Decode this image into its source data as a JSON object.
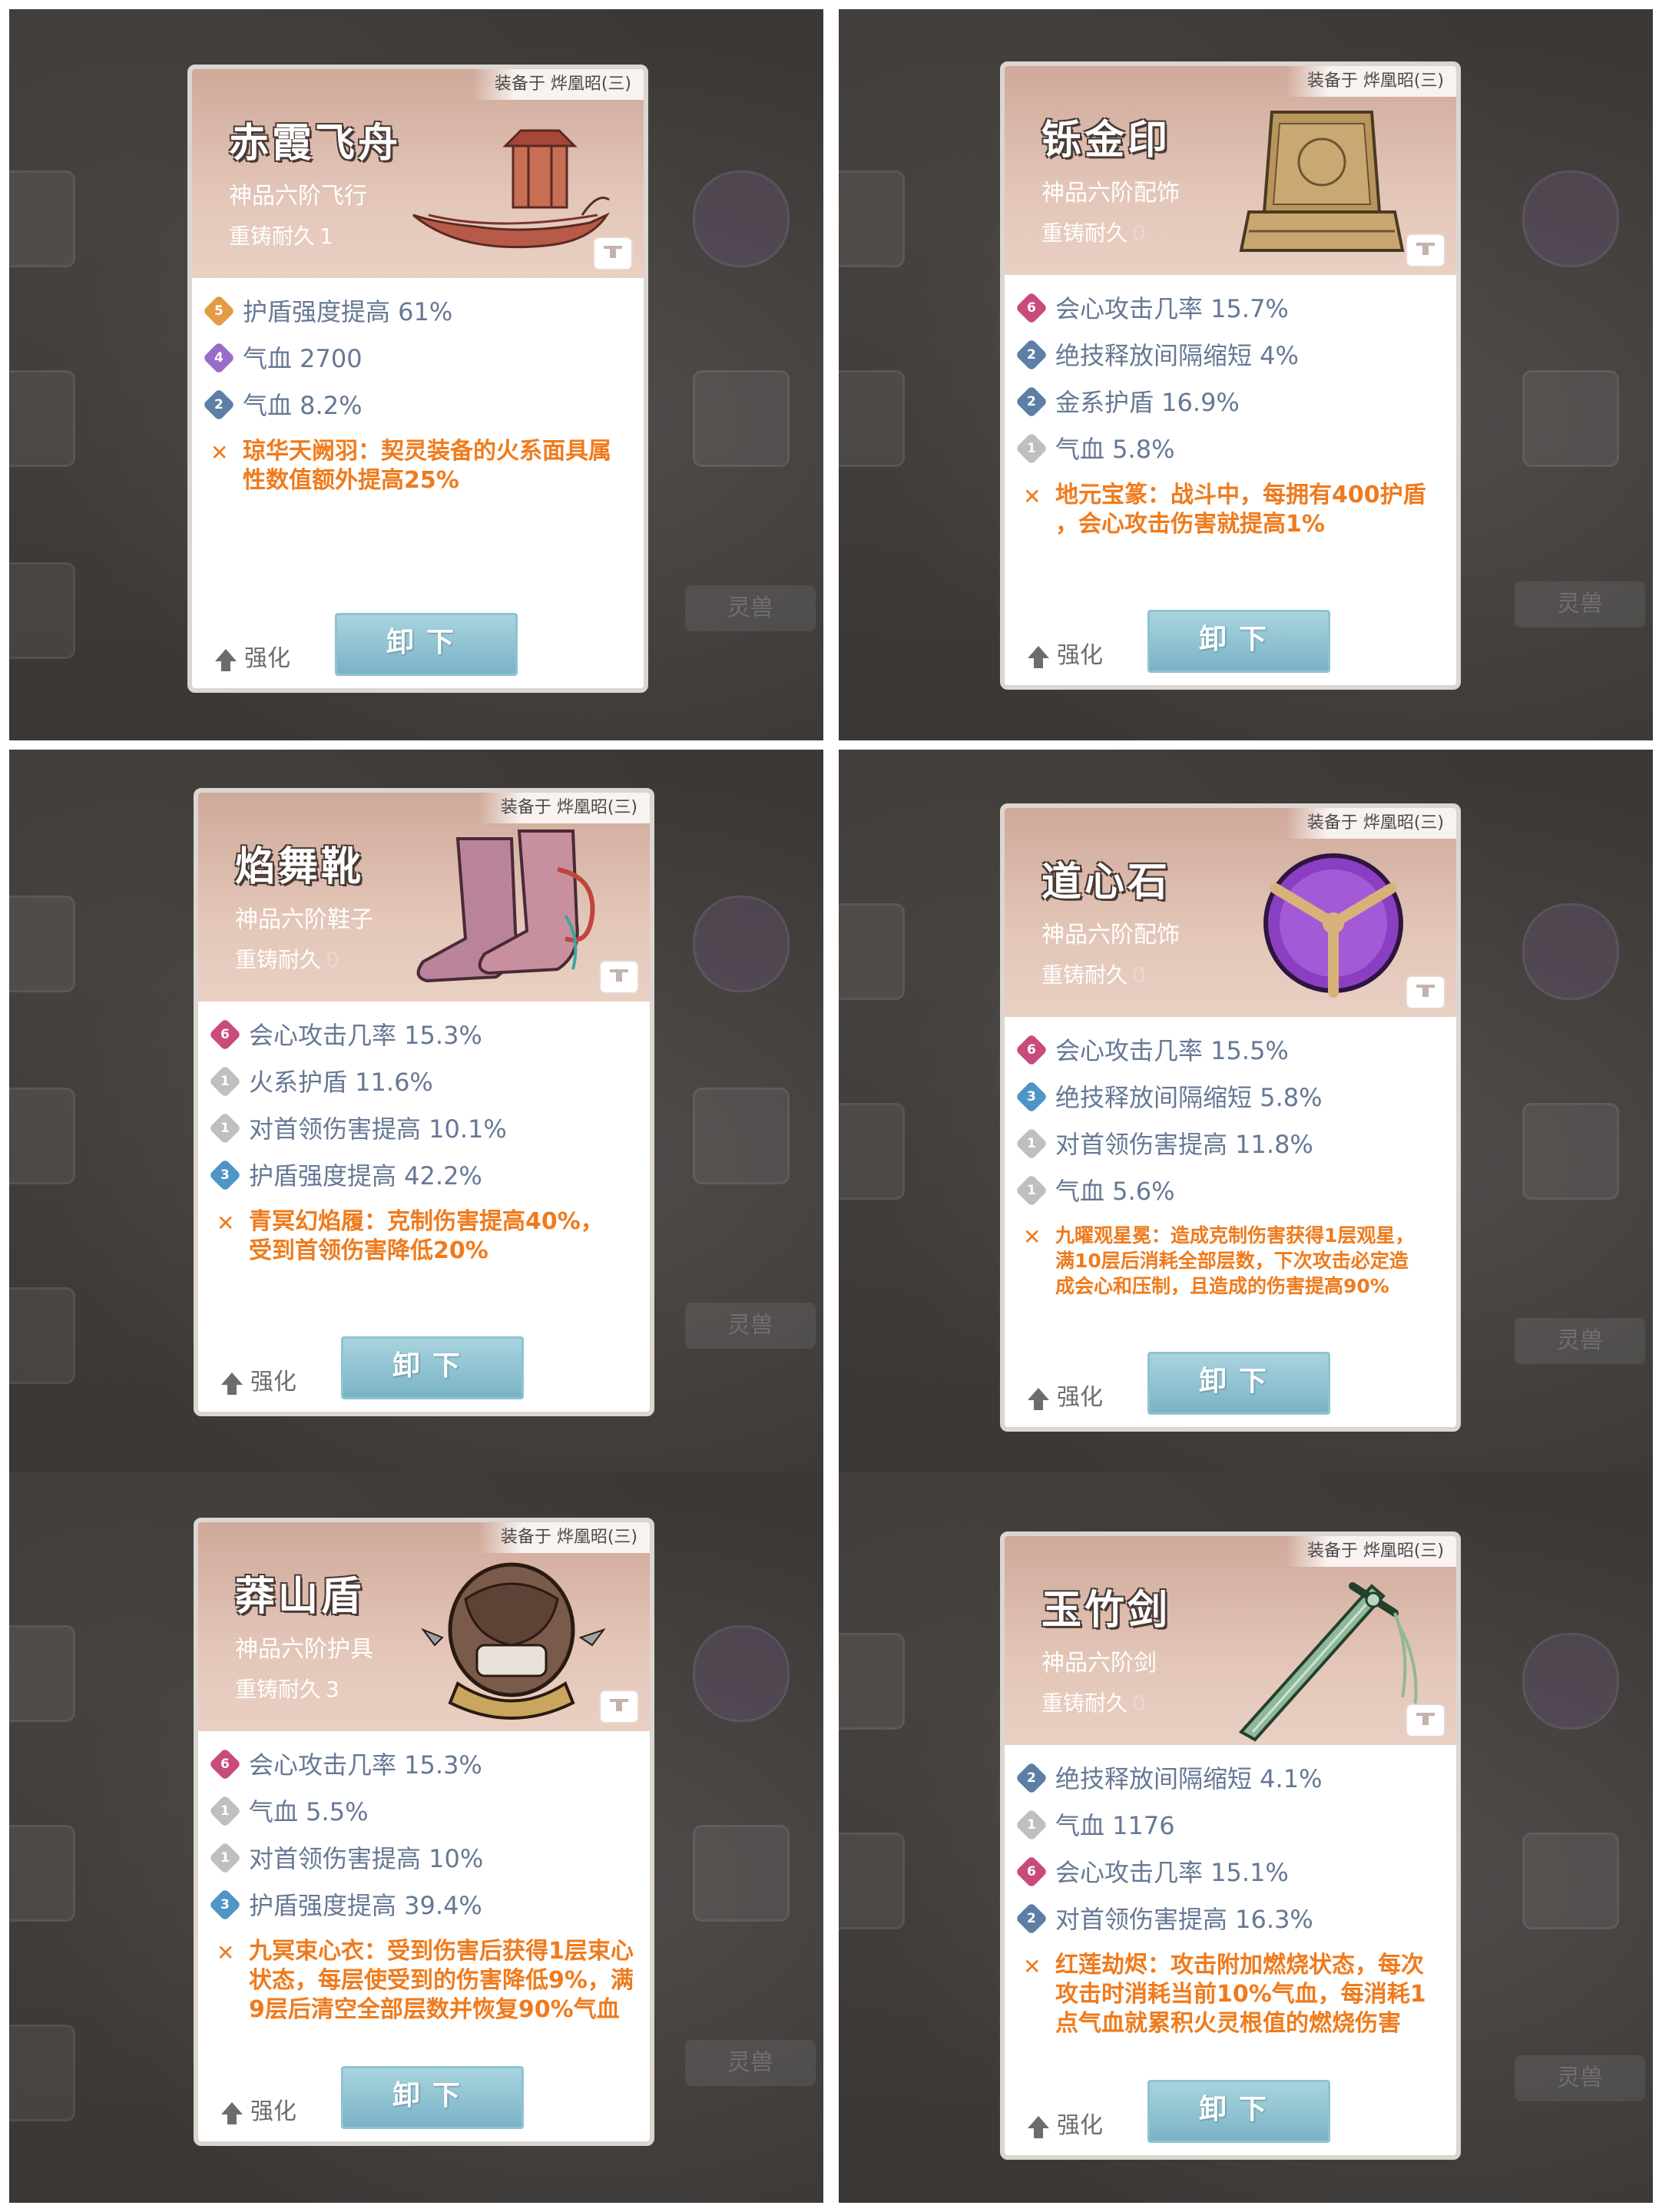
{
  "cards": [
    {
      "equip_tag": "装备于 烨凰昭(三)",
      "name": "赤霞飞舟",
      "grade": "神品六阶飞行",
      "recast_label": "重铸耐久",
      "recast_value": "1",
      "stats": [
        {
          "badge": "5",
          "color": "b5",
          "text": "护盾强度提高 61%"
        },
        {
          "badge": "4",
          "color": "b4",
          "text": "气血 2700"
        },
        {
          "badge": "2",
          "color": "b2",
          "text": "气血 8.2%"
        }
      ],
      "special_lines": [
        "琼华天阙羽：契灵装备的火系面具属",
        "性数值额外提高25%"
      ],
      "upgrade": "强化",
      "unequip": "卸下"
    },
    {
      "equip_tag": "装备于 烨凰昭(三)",
      "name": "铄金印",
      "grade": "神品六阶配饰",
      "recast_label": "重铸耐久",
      "recast_value": "0",
      "stats": [
        {
          "badge": "6",
          "color": "b6",
          "text": "会心攻击几率 15.7%"
        },
        {
          "badge": "2",
          "color": "b2",
          "text": "绝技释放间隔缩短 4%"
        },
        {
          "badge": "2",
          "color": "b2",
          "text": "金系护盾 16.9%"
        },
        {
          "badge": "1",
          "color": "b1",
          "text": "气血 5.8%"
        }
      ],
      "special_lines": [
        "地元宝篆：战斗中，每拥有400护盾",
        "，会心攻击伤害就提高1%"
      ],
      "upgrade": "强化",
      "unequip": "卸下"
    },
    {
      "equip_tag": "装备于 烨凰昭(三)",
      "name": "焰舞靴",
      "grade": "神品六阶鞋子",
      "recast_label": "重铸耐久",
      "recast_value": "0",
      "stats": [
        {
          "badge": "6",
          "color": "b6",
          "text": "会心攻击几率 15.3%"
        },
        {
          "badge": "1",
          "color": "b1",
          "text": "火系护盾 11.6%"
        },
        {
          "badge": "1",
          "color": "b1",
          "text": "对首领伤害提高 10.1%"
        },
        {
          "badge": "3",
          "color": "b3",
          "text": "护盾强度提高 42.2%"
        }
      ],
      "special_lines": [
        "青冥幻焰履：克制伤害提高40%，",
        "受到首领伤害降低20%"
      ],
      "upgrade": "强化",
      "unequip": "卸下"
    },
    {
      "equip_tag": "装备于 烨凰昭(三)",
      "name": "道心石",
      "grade": "神品六阶配饰",
      "recast_label": "重铸耐久",
      "recast_value": "0",
      "stats": [
        {
          "badge": "6",
          "color": "b6",
          "text": "会心攻击几率 15.5%"
        },
        {
          "badge": "3",
          "color": "b3",
          "text": "绝技释放间隔缩短 5.8%"
        },
        {
          "badge": "1",
          "color": "b1",
          "text": "对首领伤害提高 11.8%"
        },
        {
          "badge": "1",
          "color": "b1",
          "text": "气血 5.6%"
        }
      ],
      "special_lines": [
        "九曜观星冕：造成克制伤害获得1层观星，",
        "满10层后消耗全部层数，下次攻击必定造",
        "成会心和压制，且造成的伤害提高90%"
      ],
      "upgrade": "强化",
      "unequip": "卸下"
    },
    {
      "equip_tag": "装备于 烨凰昭(三)",
      "name": "莽山盾",
      "grade": "神品六阶护具",
      "recast_label": "重铸耐久",
      "recast_value": "3",
      "stats": [
        {
          "badge": "6",
          "color": "b6",
          "text": "会心攻击几率 15.3%"
        },
        {
          "badge": "1",
          "color": "b1",
          "text": "气血 5.5%"
        },
        {
          "badge": "1",
          "color": "b1",
          "text": "对首领伤害提高 10%"
        },
        {
          "badge": "3",
          "color": "b3",
          "text": "护盾强度提高 39.4%"
        }
      ],
      "special_lines": [
        "九冥束心衣：受到伤害后获得1层束心",
        "状态，每层使受到的伤害降低9%，满",
        "9层后清空全部层数并恢复90%气血"
      ],
      "upgrade": "强化",
      "unequip": "卸下"
    },
    {
      "equip_tag": "装备于 烨凰昭(三)",
      "name": "玉竹剑",
      "grade": "神品六阶剑",
      "recast_label": "重铸耐久",
      "recast_value": "0",
      "stats": [
        {
          "badge": "2",
          "color": "b2",
          "text": "绝技释放间隔缩短 4.1%"
        },
        {
          "badge": "1",
          "color": "b1",
          "text": "气血 1176"
        },
        {
          "badge": "6",
          "color": "b6",
          "text": "会心攻击几率 15.1%"
        },
        {
          "badge": "2",
          "color": "b2",
          "text": "对首领伤害提高 16.3%"
        }
      ],
      "special_lines": [
        "红莲劫烬：攻击附加燃烧状态，每次",
        "攻击时消耗当前10%气血，每消耗1",
        "点气血就累积火灵根值的燃烧伤害"
      ],
      "upgrade": "强化",
      "unequip": "卸下"
    }
  ],
  "background": {
    "tab_label": "灵兽"
  },
  "colors": {
    "stat_text": "#667895",
    "special_text": "#ef7b1d",
    "unequip_button": "#8fc2d2"
  }
}
